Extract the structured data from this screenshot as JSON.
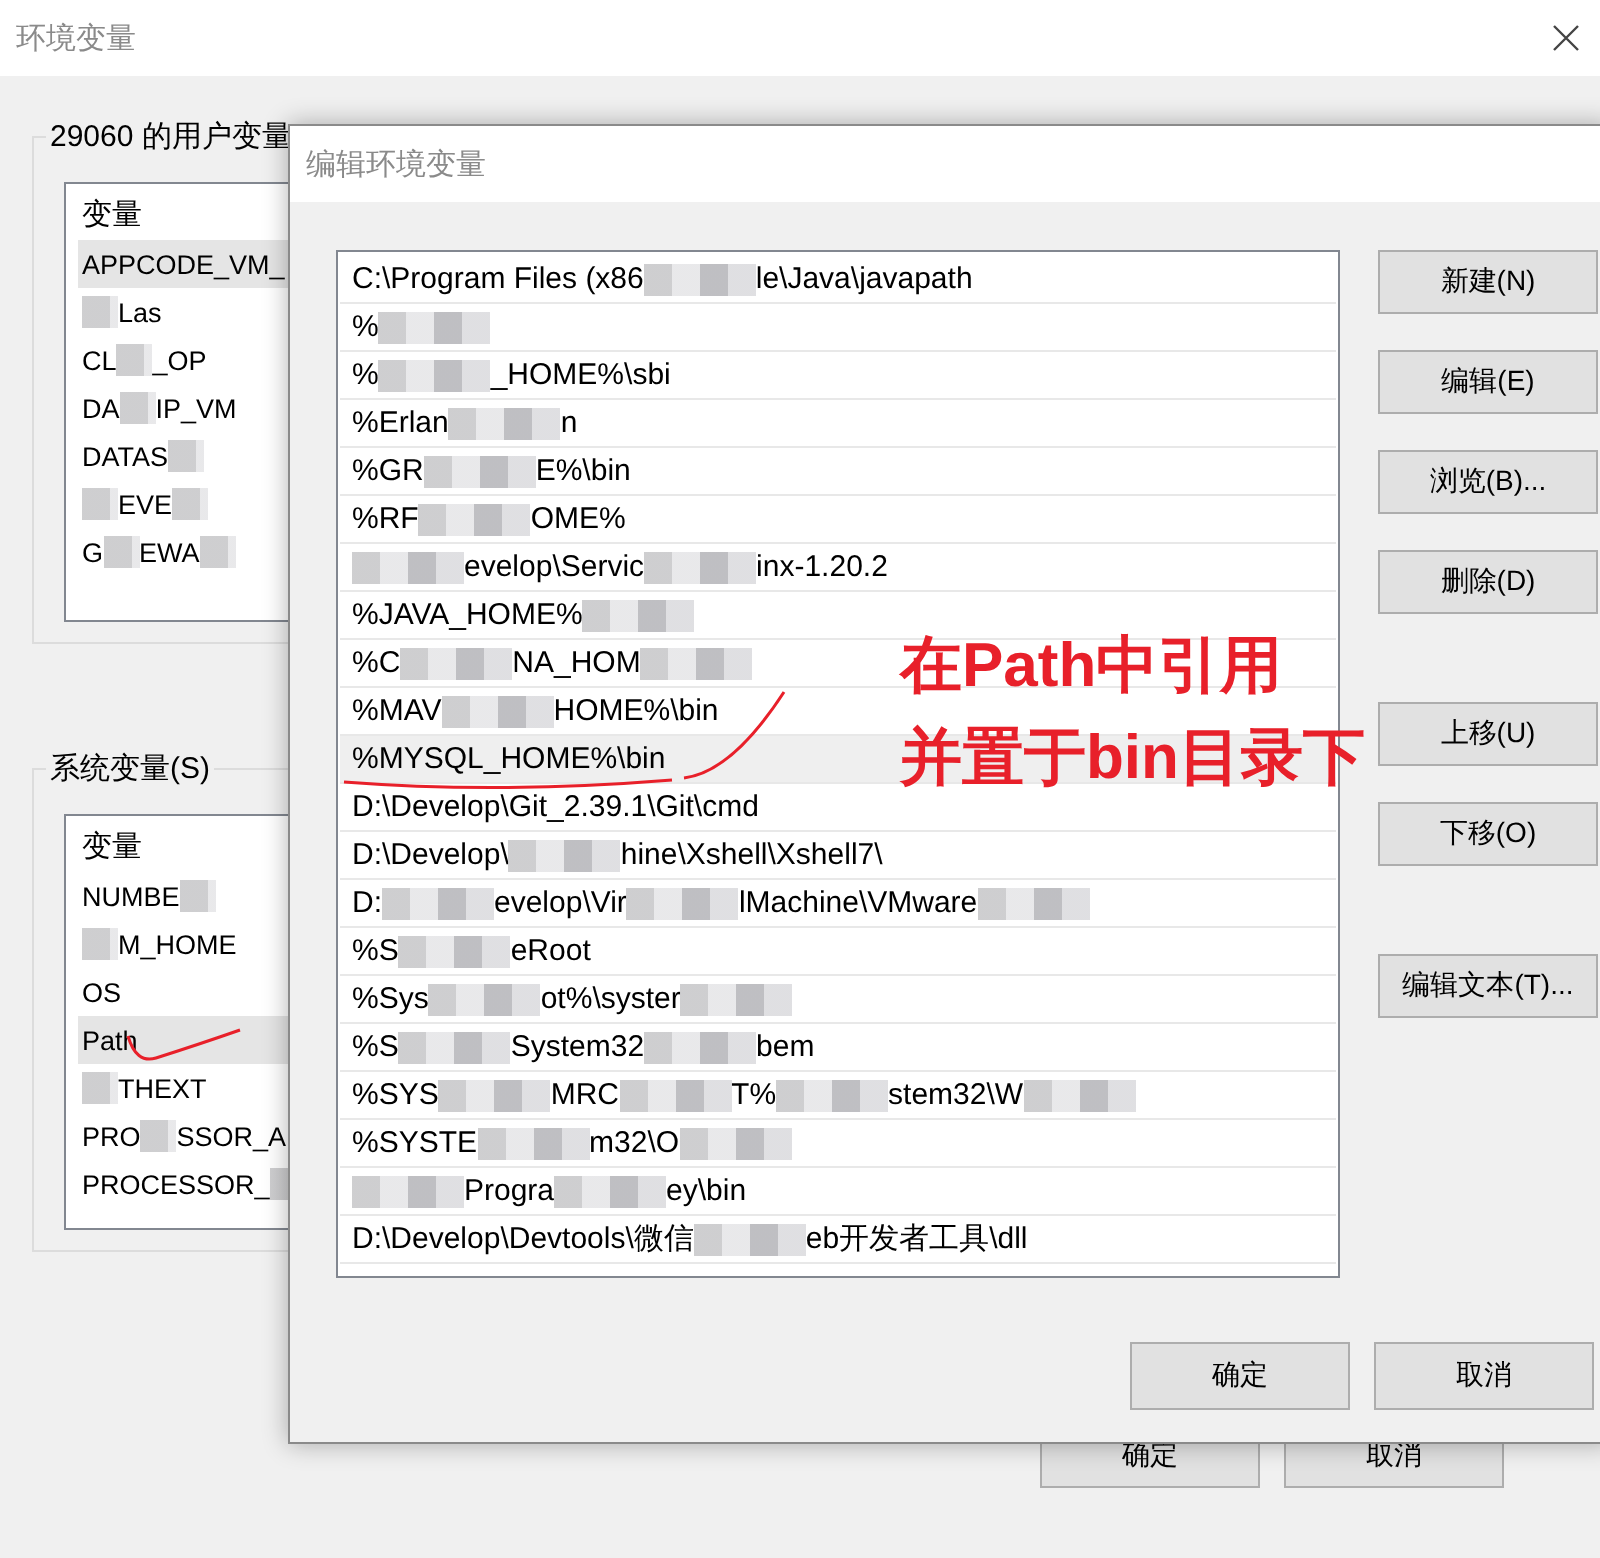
{
  "main_window": {
    "title": "环境变量",
    "user_variables": {
      "label": "29060 的用户变量",
      "column": "变量",
      "rows": [
        {
          "selected": true,
          "segments": [
            {
              "kind": "text",
              "text": "APPCODE_VM_"
            }
          ]
        },
        {
          "selected": false,
          "segments": [
            {
              "kind": "blur"
            },
            {
              "kind": "text",
              "text": "Las"
            }
          ]
        },
        {
          "selected": false,
          "segments": [
            {
              "kind": "text",
              "text": "CL"
            },
            {
              "kind": "blur"
            },
            {
              "kind": "text",
              "text": "_OP"
            }
          ]
        },
        {
          "selected": false,
          "segments": [
            {
              "kind": "text",
              "text": "DA"
            },
            {
              "kind": "blur"
            },
            {
              "kind": "text",
              "text": "IP_VM"
            }
          ]
        },
        {
          "selected": false,
          "segments": [
            {
              "kind": "text",
              "text": "DATAS"
            },
            {
              "kind": "blur"
            }
          ]
        },
        {
          "selected": false,
          "segments": [
            {
              "kind": "blur"
            },
            {
              "kind": "text",
              "text": "EVE"
            },
            {
              "kind": "blur"
            }
          ]
        },
        {
          "selected": false,
          "segments": [
            {
              "kind": "text",
              "text": "G"
            },
            {
              "kind": "blur"
            },
            {
              "kind": "text",
              "text": "EWA"
            },
            {
              "kind": "blur"
            }
          ]
        }
      ]
    },
    "system_variables": {
      "label": "系统变量(S)",
      "column": "变量",
      "rows": [
        {
          "selected": false,
          "segments": [
            {
              "kind": "text",
              "text": "NUMBE"
            },
            {
              "kind": "blur"
            }
          ]
        },
        {
          "selected": false,
          "segments": [
            {
              "kind": "blur"
            },
            {
              "kind": "text",
              "text": "M_HOME"
            }
          ]
        },
        {
          "selected": false,
          "segments": [
            {
              "kind": "text",
              "text": "OS"
            }
          ]
        },
        {
          "selected": true,
          "segments": [
            {
              "kind": "text",
              "text": "Path"
            }
          ]
        },
        {
          "selected": false,
          "segments": [
            {
              "kind": "blur"
            },
            {
              "kind": "text",
              "text": "THEXT"
            }
          ]
        },
        {
          "selected": false,
          "segments": [
            {
              "kind": "text",
              "text": "PRO"
            },
            {
              "kind": "blur"
            },
            {
              "kind": "text",
              "text": "SSOR_A"
            }
          ]
        },
        {
          "selected": false,
          "segments": [
            {
              "kind": "text",
              "text": "PROCESSOR_"
            },
            {
              "kind": "blur"
            }
          ]
        }
      ]
    },
    "buttons": [
      "确定",
      "取消"
    ]
  },
  "edit_dialog": {
    "title": "编辑环境变量",
    "entries": [
      {
        "selected": false,
        "segments": [
          {
            "kind": "text",
            "text": "C:\\Program Files (x86"
          },
          {
            "kind": "blur"
          },
          {
            "kind": "text",
            "text": "le\\Java\\javapath"
          }
        ]
      },
      {
        "selected": false,
        "segments": [
          {
            "kind": "text",
            "text": "%"
          },
          {
            "kind": "blur"
          }
        ]
      },
      {
        "selected": false,
        "segments": [
          {
            "kind": "text",
            "text": "%"
          },
          {
            "kind": "blur"
          },
          {
            "kind": "text",
            "text": "_HOME%\\sbi"
          }
        ]
      },
      {
        "selected": false,
        "segments": [
          {
            "kind": "text",
            "text": "%Erlan"
          },
          {
            "kind": "blur"
          },
          {
            "kind": "text",
            "text": "n"
          }
        ]
      },
      {
        "selected": false,
        "segments": [
          {
            "kind": "text",
            "text": "%GR"
          },
          {
            "kind": "blur"
          },
          {
            "kind": "text",
            "text": "E%\\bin"
          }
        ]
      },
      {
        "selected": false,
        "segments": [
          {
            "kind": "text",
            "text": "%RF"
          },
          {
            "kind": "blur"
          },
          {
            "kind": "text",
            "text": "OME%"
          }
        ]
      },
      {
        "selected": false,
        "segments": [
          {
            "kind": "blur"
          },
          {
            "kind": "text",
            "text": "evelop\\Servic"
          },
          {
            "kind": "blur"
          },
          {
            "kind": "text",
            "text": "inx-1.20.2"
          }
        ]
      },
      {
        "selected": false,
        "segments": [
          {
            "kind": "text",
            "text": "%JAVA_HOME%"
          },
          {
            "kind": "blur"
          }
        ]
      },
      {
        "selected": false,
        "segments": [
          {
            "kind": "text",
            "text": "%C"
          },
          {
            "kind": "blur"
          },
          {
            "kind": "text",
            "text": "NA_HOM"
          },
          {
            "kind": "blur"
          }
        ]
      },
      {
        "selected": false,
        "segments": [
          {
            "kind": "text",
            "text": "%MAV"
          },
          {
            "kind": "blur"
          },
          {
            "kind": "text",
            "text": "HOME%\\bin"
          }
        ]
      },
      {
        "selected": true,
        "segments": [
          {
            "kind": "text",
            "text": "%MYSQL_HOME%\\bin"
          }
        ]
      },
      {
        "selected": false,
        "segments": [
          {
            "kind": "text",
            "text": "D:\\Develop\\Git_2.39.1\\Git\\cmd"
          }
        ]
      },
      {
        "selected": false,
        "segments": [
          {
            "kind": "text",
            "text": "D:\\Develop\\"
          },
          {
            "kind": "blur"
          },
          {
            "kind": "text",
            "text": "hine\\Xshell\\Xshell7\\"
          }
        ]
      },
      {
        "selected": false,
        "segments": [
          {
            "kind": "text",
            "text": "D:"
          },
          {
            "kind": "blur"
          },
          {
            "kind": "text",
            "text": "evelop\\Vir"
          },
          {
            "kind": "blur"
          },
          {
            "kind": "text",
            "text": "lMachine\\VMware"
          },
          {
            "kind": "blur"
          }
        ]
      },
      {
        "selected": false,
        "segments": [
          {
            "kind": "text",
            "text": "%S"
          },
          {
            "kind": "blur"
          },
          {
            "kind": "text",
            "text": "eRoot"
          }
        ]
      },
      {
        "selected": false,
        "segments": [
          {
            "kind": "text",
            "text": "%Sys"
          },
          {
            "kind": "blur"
          },
          {
            "kind": "text",
            "text": "ot%\\syster"
          },
          {
            "kind": "blur"
          }
        ]
      },
      {
        "selected": false,
        "segments": [
          {
            "kind": "text",
            "text": "%S"
          },
          {
            "kind": "blur"
          },
          {
            "kind": "text",
            "text": "System32"
          },
          {
            "kind": "blur"
          },
          {
            "kind": "text",
            "text": "bem"
          }
        ]
      },
      {
        "selected": false,
        "segments": [
          {
            "kind": "text",
            "text": "%SYS"
          },
          {
            "kind": "blur"
          },
          {
            "kind": "text",
            "text": "MRC"
          },
          {
            "kind": "blur"
          },
          {
            "kind": "text",
            "text": "T%"
          },
          {
            "kind": "blur"
          },
          {
            "kind": "text",
            "text": "stem32\\W"
          },
          {
            "kind": "blur"
          }
        ]
      },
      {
        "selected": false,
        "segments": [
          {
            "kind": "text",
            "text": "%SYSTE"
          },
          {
            "kind": "blur"
          },
          {
            "kind": "text",
            "text": "m32\\O"
          },
          {
            "kind": "blur"
          }
        ]
      },
      {
        "selected": false,
        "segments": [
          {
            "kind": "blur"
          },
          {
            "kind": "text",
            "text": "Progra"
          },
          {
            "kind": "blur"
          },
          {
            "kind": "text",
            "text": "ey\\bin"
          }
        ]
      },
      {
        "selected": false,
        "segments": [
          {
            "kind": "text",
            "text": "D:\\Develop\\Devtools\\微信"
          },
          {
            "kind": "blur"
          },
          {
            "kind": "text",
            "text": "eb开发者工具\\dll"
          }
        ]
      }
    ],
    "side_button_groups": [
      [
        "新建(N)",
        "编辑(E)",
        "浏览(B)...",
        "删除(D)"
      ],
      [
        "上移(U)",
        "下移(O)"
      ],
      [
        "编辑文本(T)..."
      ]
    ],
    "buttons": [
      "确定",
      "取消"
    ]
  },
  "annotation": {
    "lines": [
      "在Path中引用",
      "并置于bin目录下"
    ]
  }
}
